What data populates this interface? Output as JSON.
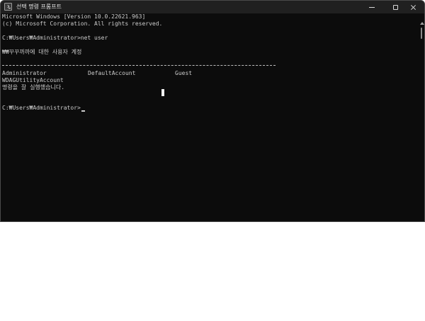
{
  "window": {
    "title": "선택 명령 프롬프트",
    "icon": "command-prompt-icon",
    "controls": {
      "minimize_icon": "minimize-icon",
      "maximize_icon": "maximize-icon",
      "close_icon": "close-icon"
    }
  },
  "console": {
    "banner_line1": "Microsoft Windows [Version 10.0.22621.963]",
    "banner_line2": "(c) Microsoft Corporation. All rights reserved.",
    "command_line": "C:₩Users₩Administrator>net user",
    "header": "₩₩꾸꾸까까에 대한 사용자 계정",
    "separator": "-------------------------------------------------------------------------------",
    "accounts": [
      "Administrator",
      "DefaultAccount",
      "Guest",
      "WDAGUtilityAccount"
    ],
    "result": "명령을 잘 실행했습니다.",
    "prompt": "C:₩Users₩Administrator>"
  },
  "colors": {
    "console_bg": "#0c0c0c",
    "console_text": "#cccccc",
    "titlebar_bg": "#202020"
  }
}
